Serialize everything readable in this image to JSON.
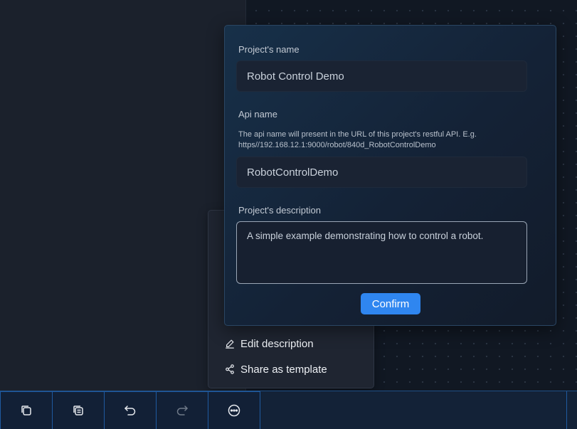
{
  "modal": {
    "project_name_label": "Project's name",
    "project_name_value": "Robot Control Demo",
    "api_name_label": "Api name",
    "api_name_hint": "The api name will present in the URL of this project's restful API. E.g. https//192.168.12.1:9000/robot/840d_RobotControlDemo",
    "api_name_value": "RobotControlDemo",
    "description_label": "Project's description",
    "description_value": "A simple example demonstrating how to control a robot.",
    "confirm_label": "Confirm"
  },
  "context_menu": {
    "items": [
      {
        "label": "Edit description",
        "icon": "edit-icon"
      },
      {
        "label": "Share as template",
        "icon": "share-icon"
      }
    ]
  },
  "toolbar": {
    "buttons": [
      {
        "icon": "copy-icon",
        "enabled": true
      },
      {
        "icon": "duplicate-icon",
        "enabled": true
      },
      {
        "icon": "undo-icon",
        "enabled": true
      },
      {
        "icon": "redo-icon",
        "enabled": false
      },
      {
        "icon": "more-icon",
        "enabled": true
      }
    ]
  },
  "colors": {
    "accent": "#2f86f0",
    "background": "#111823",
    "panel": "#1b212c",
    "toolbar_border": "#1f5aa0"
  }
}
